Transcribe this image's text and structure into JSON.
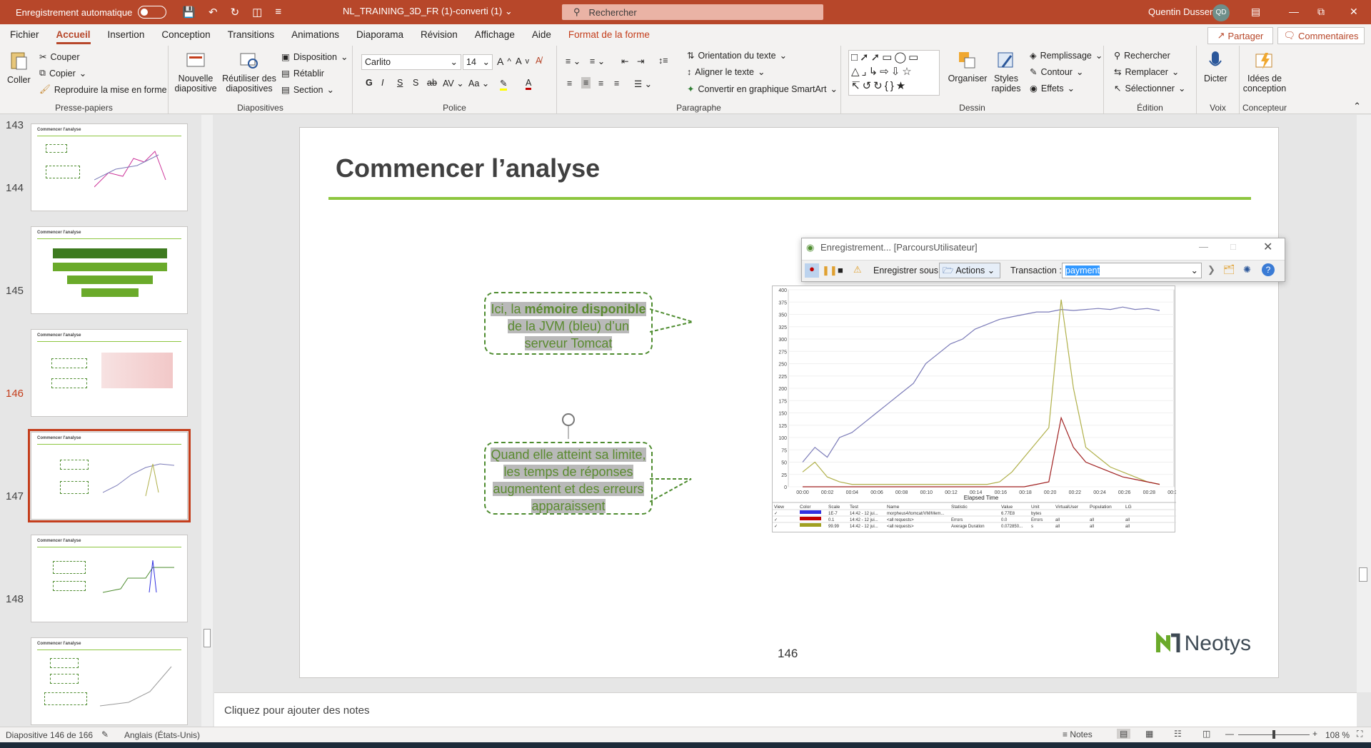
{
  "titlebar": {
    "autosave_label": "Enregistrement automatique",
    "doc_title": "NL_TRAINING_3D_FR (1)-converti (1)",
    "search_placeholder": "Rechercher",
    "user_name": "Quentin Dusser",
    "user_initials": "QD"
  },
  "menu": {
    "tabs": [
      "Fichier",
      "Accueil",
      "Insertion",
      "Conception",
      "Transitions",
      "Animations",
      "Diaporama",
      "Révision",
      "Affichage",
      "Aide",
      "Format de la forme"
    ],
    "share": "Partager",
    "comments": "Commentaires"
  },
  "ribbon": {
    "clipboard": {
      "paste": "Coller",
      "cut": "Couper",
      "copy": "Copier",
      "format_painter": "Reproduire la mise en forme",
      "label": "Presse-papiers"
    },
    "slides": {
      "new_slide": "Nouvelle diapositive",
      "reuse": "Réutiliser des diapositives",
      "layout": "Disposition",
      "reset": "Rétablir",
      "section": "Section",
      "label": "Diapositives"
    },
    "font": {
      "family": "Carlito",
      "size": "14",
      "label": "Police"
    },
    "paragraph": {
      "text_direction": "Orientation du texte",
      "align_text": "Aligner le texte",
      "smartart": "Convertir en graphique SmartArt",
      "label": "Paragraphe"
    },
    "drawing": {
      "arrange": "Organiser",
      "quick_styles": "Styles rapides",
      "fill": "Remplissage",
      "outline": "Contour",
      "effects": "Effets",
      "label": "Dessin"
    },
    "editing": {
      "find": "Rechercher",
      "replace": "Remplacer",
      "select": "Sélectionner",
      "label": "Édition"
    },
    "voice": {
      "dictate": "Dicter",
      "label": "Voix"
    },
    "designer": {
      "ideas": "Idées de conception",
      "label": "Concepteur"
    }
  },
  "thumbnails": [
    {
      "num": "143",
      "title": "Commencer l'analyse"
    },
    {
      "num": "144",
      "title": "Commencer l'analyse"
    },
    {
      "num": "145",
      "title": "Commencer l'analyse"
    },
    {
      "num": "146",
      "title": "Commencer l'analyse"
    },
    {
      "num": "147",
      "title": "Commencer l'analyse"
    },
    {
      "num": "148",
      "title": "Commencer l'analyse"
    }
  ],
  "slide": {
    "title": "Commencer l’analyse",
    "callout1_a": "Ici, la ",
    "callout1_b": "mémoire disponible",
    "callout1_c": " de la JVM (bleu) d’un serveur Tomcat",
    "callout2": "Quand elle atteint sa limite, les temps de réponses augmentent et des erreurs apparaissent",
    "page_number": "146",
    "logo_text": "Neotys"
  },
  "recorder": {
    "title": "Enregistrement... [ParcoursUtilisateur]",
    "save_under": "Enregistrer sous :",
    "actions": "Actions",
    "transaction_label": "Transaction :",
    "transaction_value": "payment"
  },
  "chart_data": {
    "type": "line",
    "xlabel": "Elapsed Time",
    "x_ticks": [
      "00:00",
      "00:02",
      "00:04",
      "00:06",
      "00:08",
      "00:10",
      "00:12",
      "00:14",
      "00:16",
      "00:18",
      "00:20",
      "00:22",
      "00:24",
      "00:26",
      "00:28",
      "00:30"
    ],
    "y_ticks": [
      0,
      25,
      50,
      75,
      100,
      125,
      150,
      175,
      200,
      225,
      250,
      275,
      300,
      325,
      350,
      375,
      400
    ],
    "ylim": [
      0,
      400
    ],
    "series": [
      {
        "color": "#7b7bb8",
        "values": [
          50,
          80,
          60,
          100,
          110,
          130,
          150,
          170,
          190,
          210,
          250,
          270,
          290,
          300,
          320,
          330,
          340,
          345,
          350,
          355,
          355,
          360,
          358,
          360,
          362,
          360,
          365,
          360,
          362,
          358
        ]
      },
      {
        "color": "#b0b04a",
        "values": [
          30,
          50,
          20,
          10,
          5,
          5,
          5,
          5,
          5,
          5,
          5,
          5,
          5,
          5,
          5,
          5,
          10,
          30,
          60,
          90,
          120,
          380,
          200,
          80,
          60,
          40,
          30,
          20,
          10,
          5
        ]
      },
      {
        "color": "#a02020",
        "values": [
          0,
          0,
          0,
          0,
          0,
          0,
          0,
          0,
          0,
          0,
          0,
          0,
          0,
          0,
          0,
          0,
          0,
          0,
          0,
          5,
          10,
          140,
          80,
          50,
          40,
          30,
          20,
          15,
          10,
          5
        ]
      }
    ],
    "legend_table": {
      "headers": [
        "View",
        "Color",
        "Scale",
        "Test",
        "Name",
        "Statistic",
        "Value",
        "Unit",
        "VirtualUser",
        "Population",
        "LG"
      ],
      "rows": [
        [
          "✓",
          "#3030e0",
          "1E-7",
          "14:42 - 12 jui...",
          "morpheus4/tomcat/VM/Mem...",
          "",
          "6.77E8",
          "bytes",
          "",
          "",
          ""
        ],
        [
          "✓",
          "#c00000",
          "0.1",
          "14:42 - 12 jui...",
          "<all requests>",
          "Errors",
          "0.0",
          "Errors",
          "all",
          "all",
          "all"
        ],
        [
          "✓",
          "#a0a020",
          "99.99",
          "14:42 - 12 jui...",
          "<all requests>",
          "Average Duration",
          "0.072850...",
          "s",
          "all",
          "all",
          "all"
        ]
      ]
    }
  },
  "notes": {
    "placeholder": "Cliquez pour ajouter des notes"
  },
  "status": {
    "slide_info": "Diapositive 146 de 166",
    "language": "Anglais (États-Unis)",
    "notes_btn": "Notes",
    "zoom": "108 %"
  }
}
